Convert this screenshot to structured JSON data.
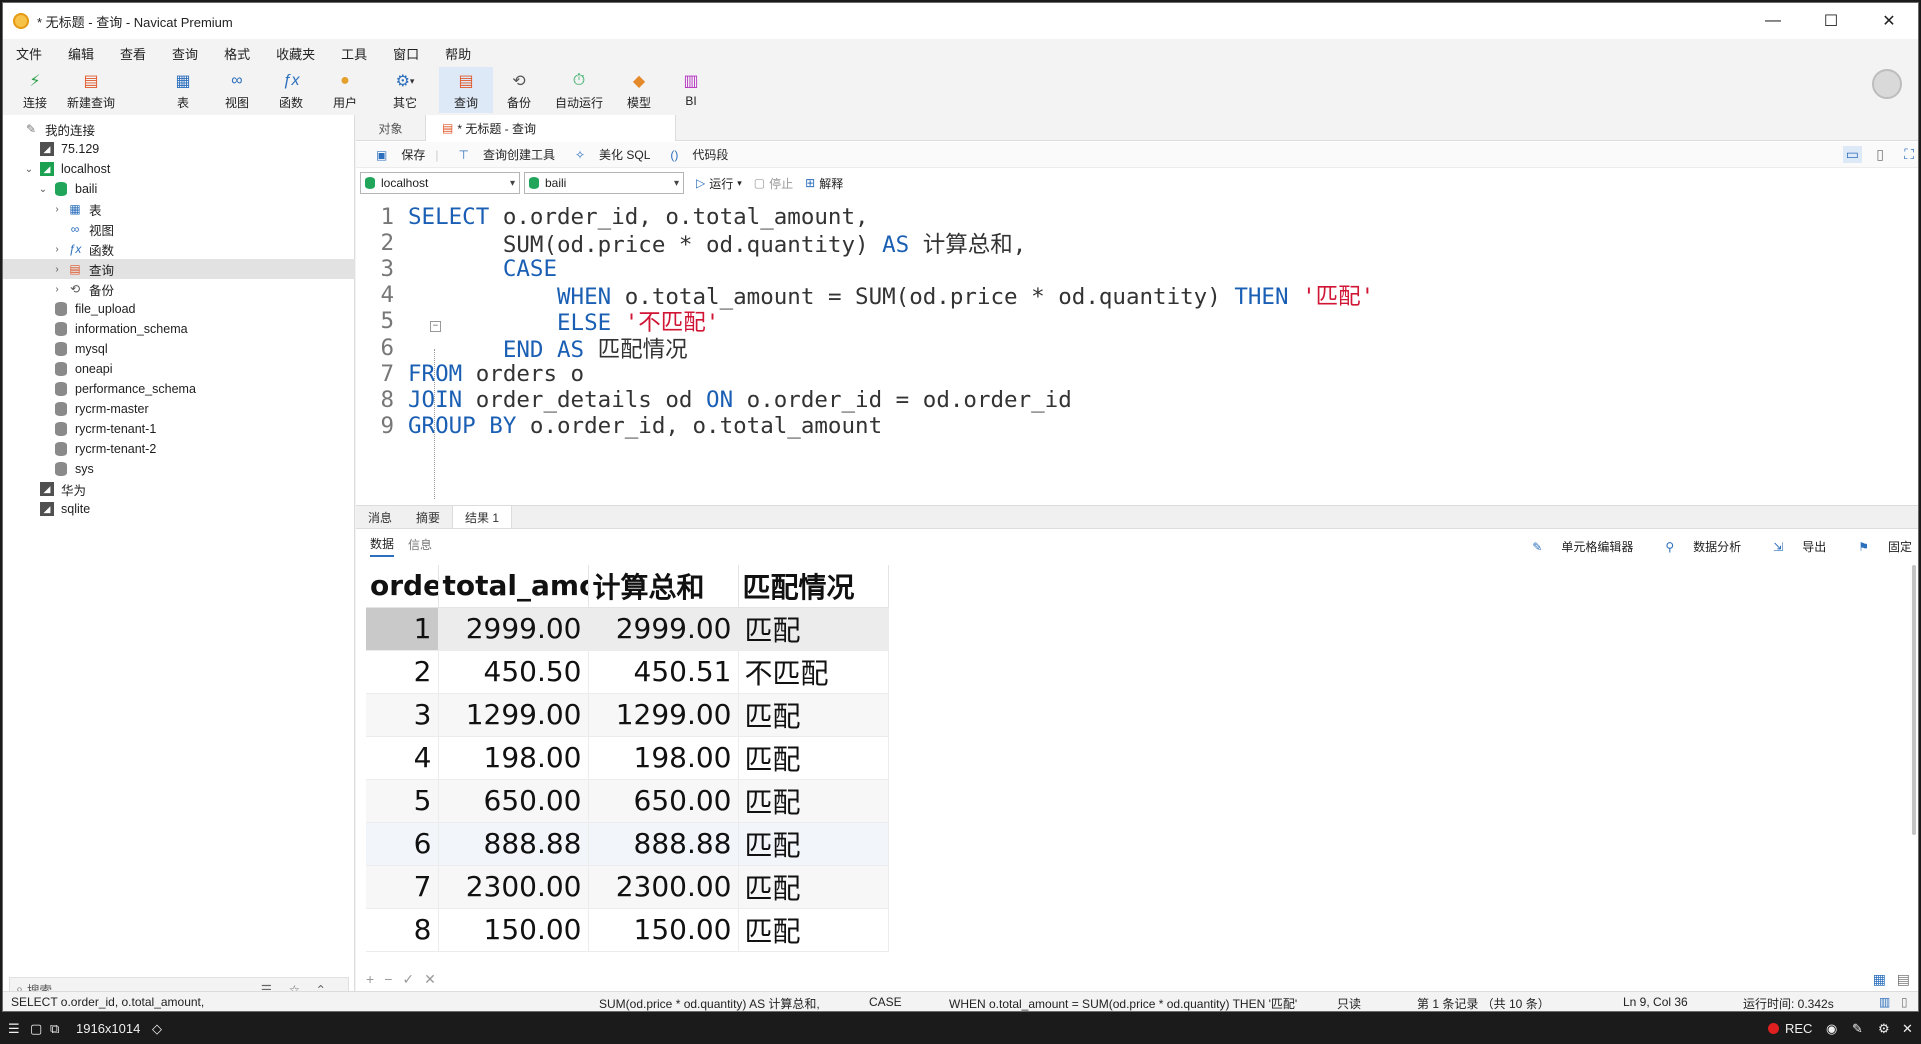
{
  "window": {
    "title": "* 无标题 - 查询 - Navicat Premium",
    "controls": [
      "—",
      "☐",
      "✕"
    ]
  },
  "menu": [
    "文件",
    "编辑",
    "查看",
    "查询",
    "格式",
    "收藏夹",
    "工具",
    "窗口",
    "帮助"
  ],
  "toolbar": [
    {
      "label": "连接",
      "icon": "plug-icon",
      "glyph": "🔌"
    },
    {
      "label": "新建查询",
      "icon": "new-query-icon",
      "glyph": "📝"
    },
    {
      "label": "表",
      "icon": "table-icon",
      "glyph": "▦"
    },
    {
      "label": "视图",
      "icon": "view-icon",
      "glyph": "👓"
    },
    {
      "label": "函数",
      "icon": "function-icon",
      "glyph": "ƒx"
    },
    {
      "label": "用户",
      "icon": "user-icon",
      "glyph": "👤"
    },
    {
      "label": "其它",
      "icon": "other-icon",
      "glyph": "⚙"
    },
    {
      "label": "查询",
      "icon": "query-icon",
      "glyph": "▤"
    },
    {
      "label": "备份",
      "icon": "backup-icon",
      "glyph": "⟲"
    },
    {
      "label": "自动运行",
      "icon": "auto-run-icon",
      "glyph": "⏱"
    },
    {
      "label": "模型",
      "icon": "model-icon",
      "glyph": "◆"
    },
    {
      "label": "BI",
      "icon": "bi-icon",
      "glyph": "📊"
    }
  ],
  "sidebar": {
    "root": "我的连接",
    "items": [
      {
        "label": "75.129",
        "level": 1,
        "type": "conn"
      },
      {
        "label": "localhost",
        "level": 1,
        "type": "conn-open",
        "expanded": true
      },
      {
        "label": "baili",
        "level": 2,
        "type": "db-open",
        "expanded": true
      },
      {
        "label": "表",
        "level": 3,
        "type": "table",
        "collapsed": true
      },
      {
        "label": "视图",
        "level": 3,
        "type": "view"
      },
      {
        "label": "函数",
        "level": 3,
        "type": "func",
        "collapsed": true
      },
      {
        "label": "查询",
        "level": 3,
        "type": "query",
        "collapsed": true,
        "selected": true
      },
      {
        "label": "备份",
        "level": 3,
        "type": "backup",
        "collapsed": true
      },
      {
        "label": "file_upload",
        "level": 2,
        "type": "db"
      },
      {
        "label": "information_schema",
        "level": 2,
        "type": "db"
      },
      {
        "label": "mysql",
        "level": 2,
        "type": "db"
      },
      {
        "label": "oneapi",
        "level": 2,
        "type": "db"
      },
      {
        "label": "performance_schema",
        "level": 2,
        "type": "db"
      },
      {
        "label": "rycrm-master",
        "level": 2,
        "type": "db"
      },
      {
        "label": "rycrm-tenant-1",
        "level": 2,
        "type": "db"
      },
      {
        "label": "rycrm-tenant-2",
        "level": 2,
        "type": "db"
      },
      {
        "label": "sys",
        "level": 2,
        "type": "db"
      },
      {
        "label": "华为",
        "level": 1,
        "type": "conn"
      },
      {
        "label": "sqlite",
        "level": 1,
        "type": "conn"
      }
    ],
    "search_placeholder": "搜索"
  },
  "tabs": [
    "对象",
    "* 无标题 - 查询"
  ],
  "query_toolbar": {
    "save": "保存",
    "builder": "查询创建工具",
    "beautify": "美化 SQL",
    "snippet": "代码段"
  },
  "selectors": {
    "connection": "localhost",
    "database": "baili",
    "run": "运行",
    "stop": "停止",
    "explain": "解释"
  },
  "sql_lines": [
    [
      [
        "kw",
        "SELECT "
      ],
      [
        "id",
        "o.order_id, o.total_amount,"
      ]
    ],
    [
      [
        "id",
        "       SUM(od.price * od.quantity) "
      ],
      [
        "kw",
        "AS"
      ],
      [
        "id",
        " 计算总和,"
      ]
    ],
    [
      [
        "kw",
        "       CASE"
      ]
    ],
    [
      [
        "kw",
        "           WHEN"
      ],
      [
        "id",
        " o.total_amount = SUM(od.price * od.quantity) "
      ],
      [
        "kw",
        "THEN"
      ],
      [
        "id",
        " "
      ],
      [
        "str",
        "'匹配'"
      ]
    ],
    [
      [
        "kw",
        "           ELSE"
      ],
      [
        "id",
        " "
      ],
      [
        "str",
        "'不匹配'"
      ]
    ],
    [
      [
        "kw",
        "       END AS"
      ],
      [
        "id",
        " 匹配情况"
      ]
    ],
    [
      [
        "kw",
        "FROM"
      ],
      [
        "id",
        " orders o"
      ]
    ],
    [
      [
        "kw",
        "JOIN"
      ],
      [
        "id",
        " order_details od "
      ],
      [
        "kw",
        "ON"
      ],
      [
        "id",
        " o.order_id = od.order_id"
      ]
    ],
    [
      [
        "kw",
        "GROUP BY"
      ],
      [
        "id",
        " o.order_id, o.total_amount"
      ]
    ]
  ],
  "result_tabs": [
    "消息",
    "摘要",
    "结果 1"
  ],
  "result_subtabs": [
    "数据",
    "信息"
  ],
  "result_tools": [
    "单元格编辑器",
    "数据分析",
    "导出",
    "固定"
  ],
  "grid": {
    "columns": [
      "orde",
      "total_amc",
      "计算总和",
      "匹配情况"
    ],
    "rows": [
      [
        "1",
        "2999.00",
        "2999.00",
        "匹配"
      ],
      [
        "2",
        "450.50",
        "450.51",
        "不匹配"
      ],
      [
        "3",
        "1299.00",
        "1299.00",
        "匹配"
      ],
      [
        "4",
        "198.00",
        "198.00",
        "匹配"
      ],
      [
        "5",
        "650.00",
        "650.00",
        "匹配"
      ],
      [
        "6",
        "888.88",
        "888.88",
        "匹配"
      ],
      [
        "7",
        "2300.00",
        "2300.00",
        "匹配"
      ],
      [
        "8",
        "150.00",
        "150.00",
        "匹配"
      ]
    ]
  },
  "grid_footer": [
    "+",
    "−",
    "✓",
    "✕"
  ],
  "status": {
    "sql1": "SELECT o.order_id, o.total_amount,",
    "sql2": "SUM(od.price * od.quantity) AS 计算总和,",
    "sql3": "CASE",
    "sql4": "WHEN o.total_amount = SUM(od.price * od.quantity) THEN '匹配'",
    "readonly": "只读",
    "records": "第 1 条记录 （共 10 条）",
    "position": "Ln 9, Col 36",
    "runtime": "运行时间: 0.342s"
  },
  "recorder": {
    "size": "1916x1014",
    "rec": "REC"
  }
}
